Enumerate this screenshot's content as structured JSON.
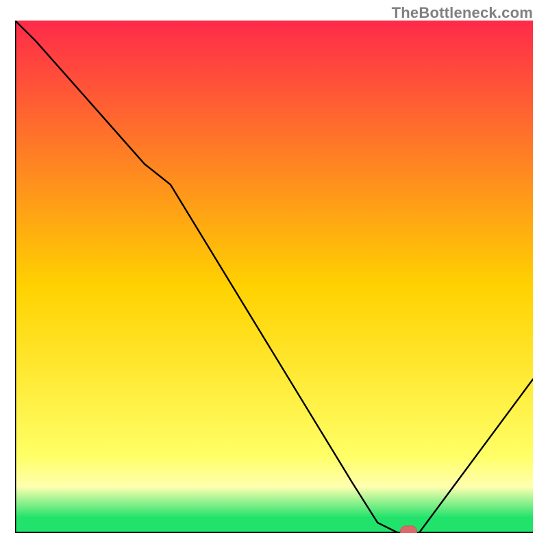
{
  "watermark": "TheBottleneck.com",
  "colors": {
    "axis": "#000000",
    "line": "#000000",
    "marker_fill": "#d86a6a",
    "marker_stroke": "#c75a5a",
    "gradient_top": "#ff2a4a",
    "gradient_mid": "#ffd200",
    "gradient_yellowband_top": "#ffff66",
    "gradient_yellowband_bot": "#ffffa0",
    "gradient_green": "#21e36b"
  },
  "chart_data": {
    "type": "line",
    "title": "",
    "xlabel": "",
    "ylabel": "",
    "xlim": [
      0,
      100
    ],
    "ylim": [
      0,
      100
    ],
    "gradient_bands": [
      {
        "y": 100,
        "color": "#ff2a4a"
      },
      {
        "y": 48,
        "color": "#ffd200"
      },
      {
        "y": 15,
        "color": "#ffff66"
      },
      {
        "y": 9,
        "color": "#ffffb0"
      },
      {
        "y": 3,
        "color": "#21e36b"
      },
      {
        "y": 0,
        "color": "#21e36b"
      }
    ],
    "x": [
      0,
      4,
      25,
      30,
      65,
      70,
      74,
      78,
      100
    ],
    "values": [
      100,
      96,
      72,
      68,
      10,
      2,
      0,
      0,
      30
    ],
    "marker": {
      "x": 76,
      "y": 0,
      "w": 3.2,
      "h": 2.2
    }
  }
}
